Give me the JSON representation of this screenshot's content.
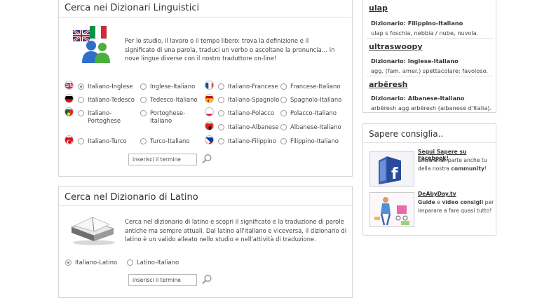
{
  "ling": {
    "title": "Cerca nei Dizionari Linguistici",
    "intro": "Per lo studio, il lavoro o il tempo libero: trova la definizione e il significato di una parola, traduci un verbo o ascoltane la pronuncia… in nove lingue diverse con il nostro traduttore on-line!",
    "options": [
      {
        "label": "Italiano-Inglese",
        "checked": true
      },
      {
        "label": "Inglese-Italiano"
      },
      {
        "label": "Italiano-Francese"
      },
      {
        "label": "Francese-Italiano"
      },
      {
        "label": "Italiano-Tedesco"
      },
      {
        "label": "Tedesco-Italiano"
      },
      {
        "label": "Italiano-Spagnolo"
      },
      {
        "label": "Spagnolo-Italiano"
      },
      {
        "label": "Italiano-Portoghese"
      },
      {
        "label": "Portoghese-Italiano"
      },
      {
        "label": "Italiano-Polacco"
      },
      {
        "label": "Polacco-Italiano"
      },
      {
        "label": "Italiano-Albanese"
      },
      {
        "label": "Albanese-Italiano"
      },
      {
        "label": "Italiano-Turco"
      },
      {
        "label": "Turco-Italiano"
      },
      {
        "label": "Italiano-Filippino"
      },
      {
        "label": "Filippino-Italiano"
      }
    ],
    "search_value": "inserisci il termine"
  },
  "latin": {
    "title": "Cerca nel Dizionario di Latino",
    "intro": "Cerca nel dizionario di latino e scopri il significato e la traduzione di parole antiche ma sempre attuali. Dal latino all'italiano e viceversa, il dizionario di latino è un valido alleato nello studio e nell'attività di traduzione.",
    "options": [
      {
        "label": "Italiano-Latino",
        "checked": true
      },
      {
        "label": "Latino-Italiano"
      }
    ],
    "search_value": "inserisci il termine"
  },
  "words": [
    {
      "word": "ulap",
      "dict": "Dizionario: Filippino-Italiano",
      "def": "ulap s foschia, nebbia / nube, nuvola."
    },
    {
      "word": "ultraswoopy",
      "dict": "Dizionario: Inglese-Italiano",
      "def": "agg. (fam. amer.) spettacolare; favoloso."
    },
    {
      "word": "arbëresh",
      "dict": "Dizionario: Albanese-Italiano",
      "def": "arbëresh agg arbëresh (albanese d'Italia)."
    }
  ],
  "sapere": {
    "title": "Sapere consiglia..",
    "fb_title": "Segui Sapere su Facebook!",
    "fb_text_1": "Entra a far parte anche tu della nostra ",
    "fb_text_bold": "community",
    "fb_text_2": "!",
    "dd_title": "DeAbyDay.tv",
    "dd_bold1": "Guide",
    "dd_text_1": " e ",
    "dd_bold2": "video consigli",
    "dd_text_2": " per imparare a fare quasi tutto!"
  }
}
